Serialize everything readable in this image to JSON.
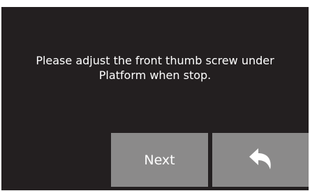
{
  "dialog": {
    "message": "Please adjust the front thumb screw under\nPlatform when stop.",
    "next_label": "Next",
    "back_icon": "back-arrow-icon"
  },
  "colors": {
    "screen_bg": "#231f20",
    "button_bg": "#8b8a8a",
    "text": "#ffffff"
  }
}
